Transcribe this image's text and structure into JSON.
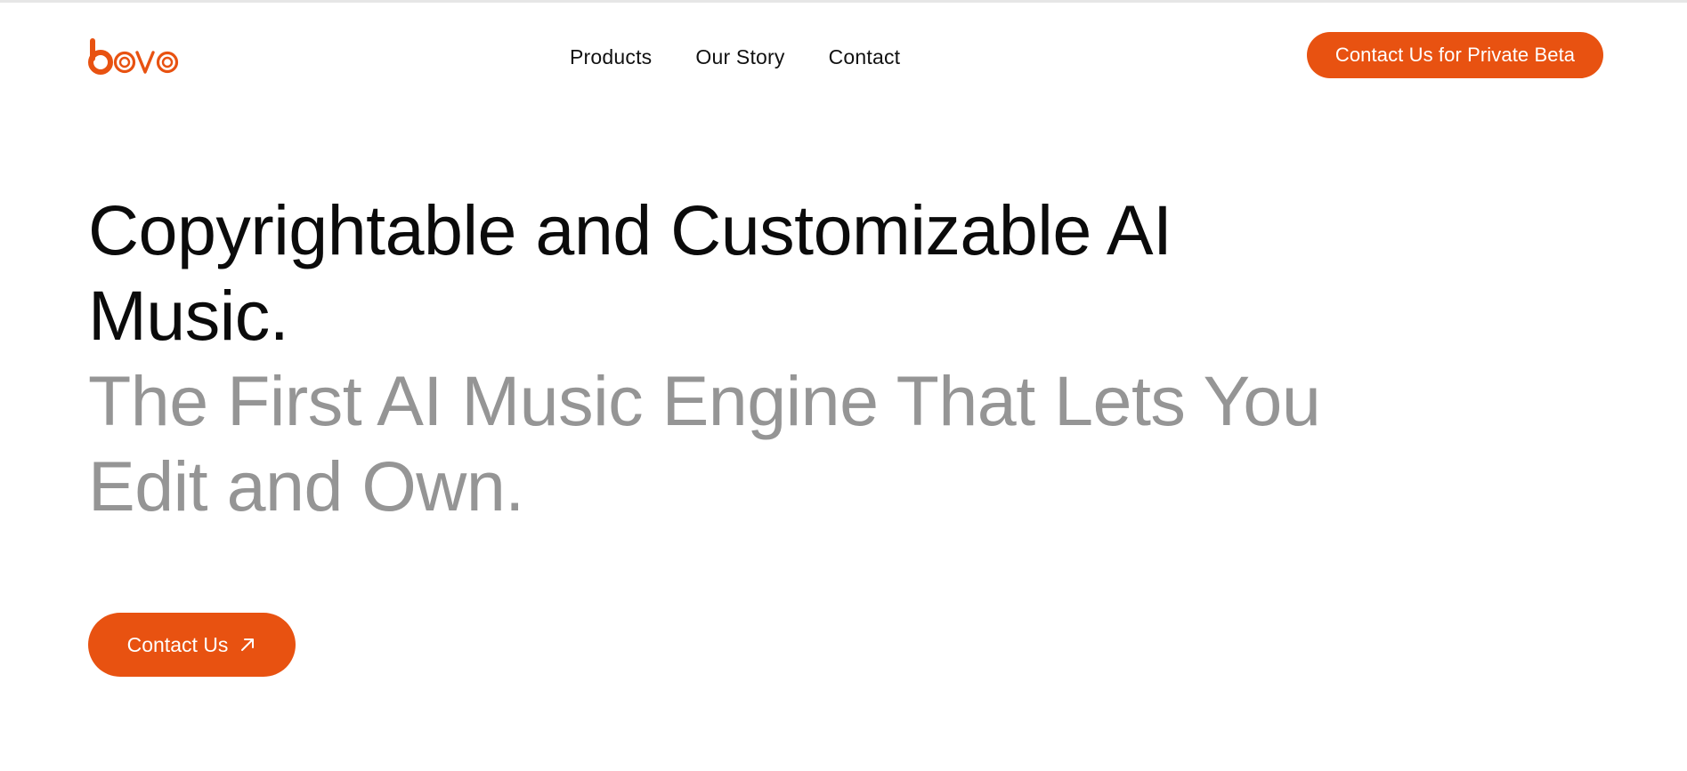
{
  "brand": {
    "logo_text": "bovo",
    "accent_color": "#e85211"
  },
  "nav": {
    "items": [
      {
        "label": "Products"
      },
      {
        "label": "Our Story"
      },
      {
        "label": "Contact"
      }
    ]
  },
  "header": {
    "beta_button_label": "Contact Us for Private Beta"
  },
  "hero": {
    "headline_line1": "Copyrightable and Customizable AI",
    "headline_line2": "Music.",
    "subhead_line1": "The First AI Music Engine That Lets You",
    "subhead_line2": "Edit and Own.",
    "cta_label": "Contact Us",
    "cta_icon": "arrow-up-right-icon",
    "subhead_color": "#959595"
  }
}
